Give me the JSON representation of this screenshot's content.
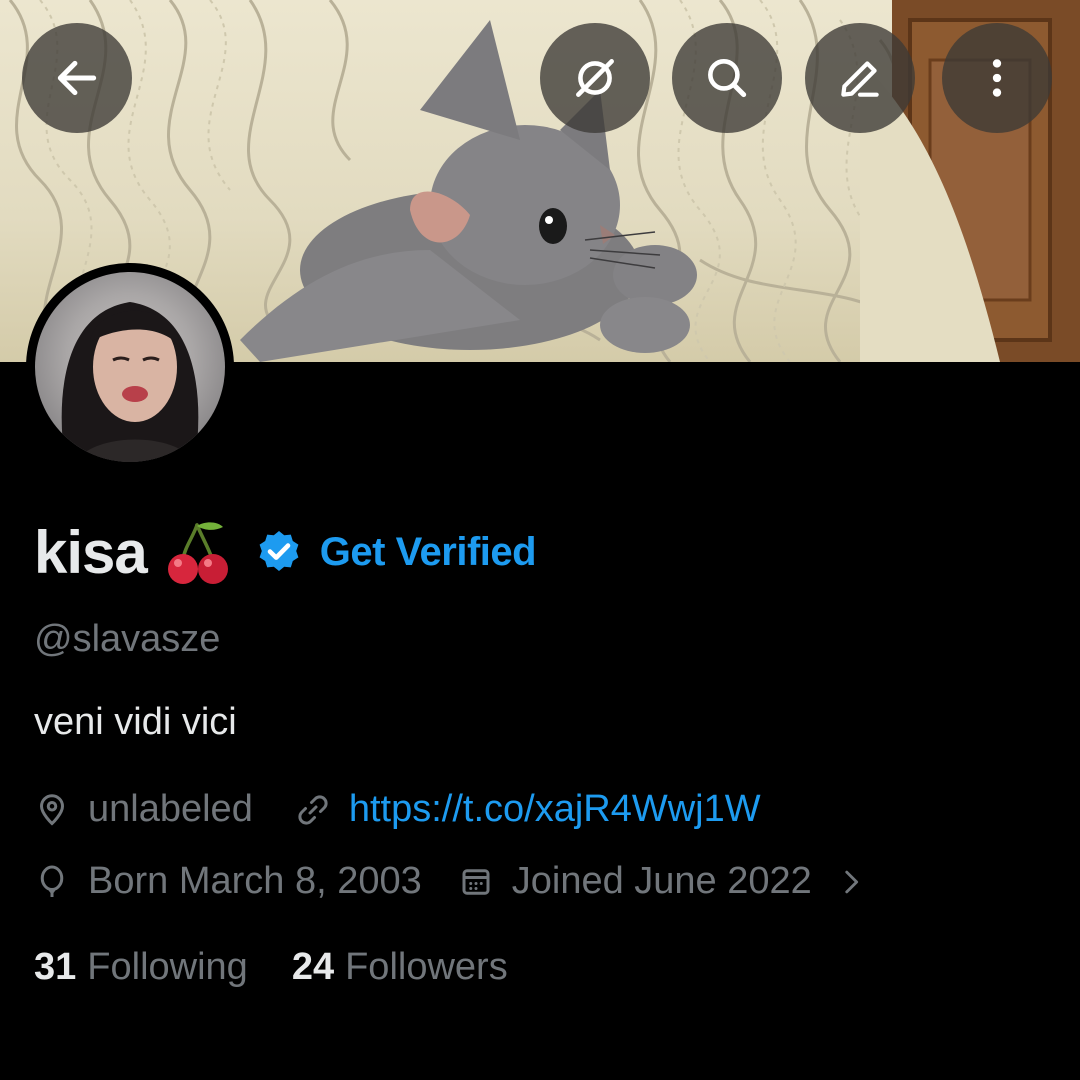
{
  "header": {
    "back_icon": "arrow-left-icon",
    "grok_icon": "grok-icon",
    "search_icon": "search-icon",
    "edit_icon": "pencil-icon",
    "more_icon": "more-vertical-icon"
  },
  "profile": {
    "display_name": "kisa",
    "name_emoji": "cherries-emoji",
    "verified_badge_icon": "verified-badge-icon",
    "get_verified_label": "Get Verified",
    "handle": "@slavasze",
    "bio": "veni vidi vici",
    "location": "unlabeled",
    "website": "https://t.co/xajR4Wwj1W",
    "birthday": "Born March 8, 2003",
    "joined": "Joined June 2022",
    "following_count": "31",
    "following_label": "Following",
    "followers_count": "24",
    "followers_label": "Followers"
  },
  "colors": {
    "background": "#000000",
    "accent": "#1d9bf0",
    "primary_text": "#e7e9ea",
    "secondary_text": "#71767b"
  }
}
